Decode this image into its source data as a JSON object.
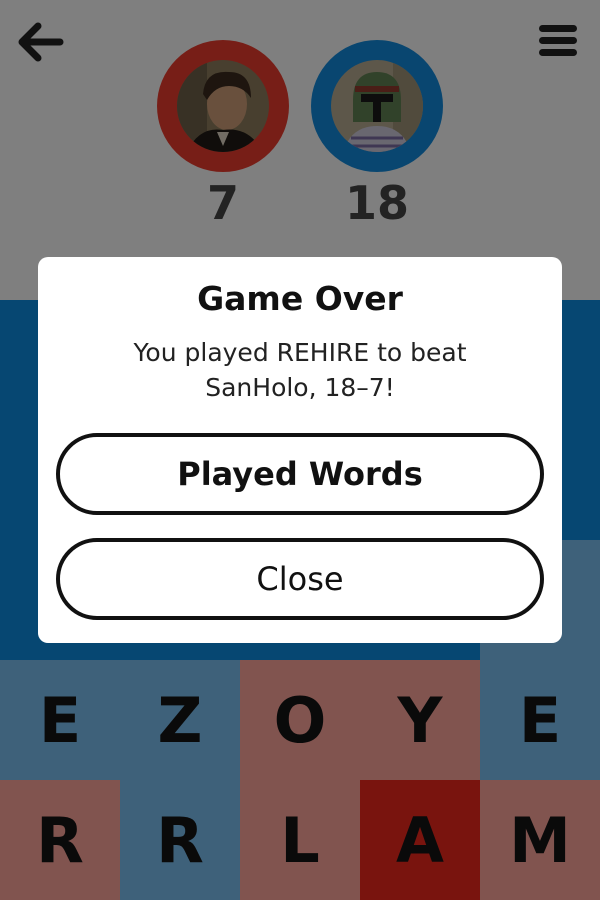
{
  "header": {
    "back_icon": "arrow-left-icon",
    "menu_icon": "hamburger-menu-icon",
    "players": [
      {
        "color": "#e53b2d",
        "avatar": "player-avatar-red",
        "score": "7"
      },
      {
        "color": "#1287d6",
        "avatar": "player-avatar-blue",
        "score": "18"
      }
    ]
  },
  "board": {
    "tiles": [
      {
        "letter": "",
        "color": "#0d89da"
      },
      {
        "letter": "",
        "color": "#0d89da"
      },
      {
        "letter": "",
        "color": "#0d89da"
      },
      {
        "letter": "",
        "color": "#0d89da"
      },
      {
        "letter": "",
        "color": "#0d89da"
      },
      {
        "letter": "",
        "color": "#0d89da"
      },
      {
        "letter": "",
        "color": "#0d89da"
      },
      {
        "letter": "",
        "color": "#0d89da"
      },
      {
        "letter": "",
        "color": "#0d89da"
      },
      {
        "letter": "",
        "color": "#0d89da"
      },
      {
        "letter": "",
        "color": "#0d89da"
      },
      {
        "letter": "",
        "color": "#0d89da"
      },
      {
        "letter": "",
        "color": "#0d89da"
      },
      {
        "letter": "",
        "color": "#0d89da"
      },
      {
        "letter": "",
        "color": "#78bbea"
      },
      {
        "letter": "E",
        "color": "#78bbea"
      },
      {
        "letter": "Z",
        "color": "#78bbea"
      },
      {
        "letter": "O",
        "color": "#f7a198"
      },
      {
        "letter": "Y",
        "color": "#f7a198"
      },
      {
        "letter": "E",
        "color": "#78bbea"
      },
      {
        "letter": "R",
        "color": "#f7a198"
      },
      {
        "letter": "R",
        "color": "#78bbea"
      },
      {
        "letter": "L",
        "color": "#f7a198"
      },
      {
        "letter": "A",
        "color": "#e8281c"
      },
      {
        "letter": "M",
        "color": "#f7a198"
      }
    ]
  },
  "dialog": {
    "title": "Game Over",
    "message": "You played REHIRE to beat SanHolo, 18–7!",
    "played_words_label": "Played Words",
    "close_label": "Close"
  }
}
